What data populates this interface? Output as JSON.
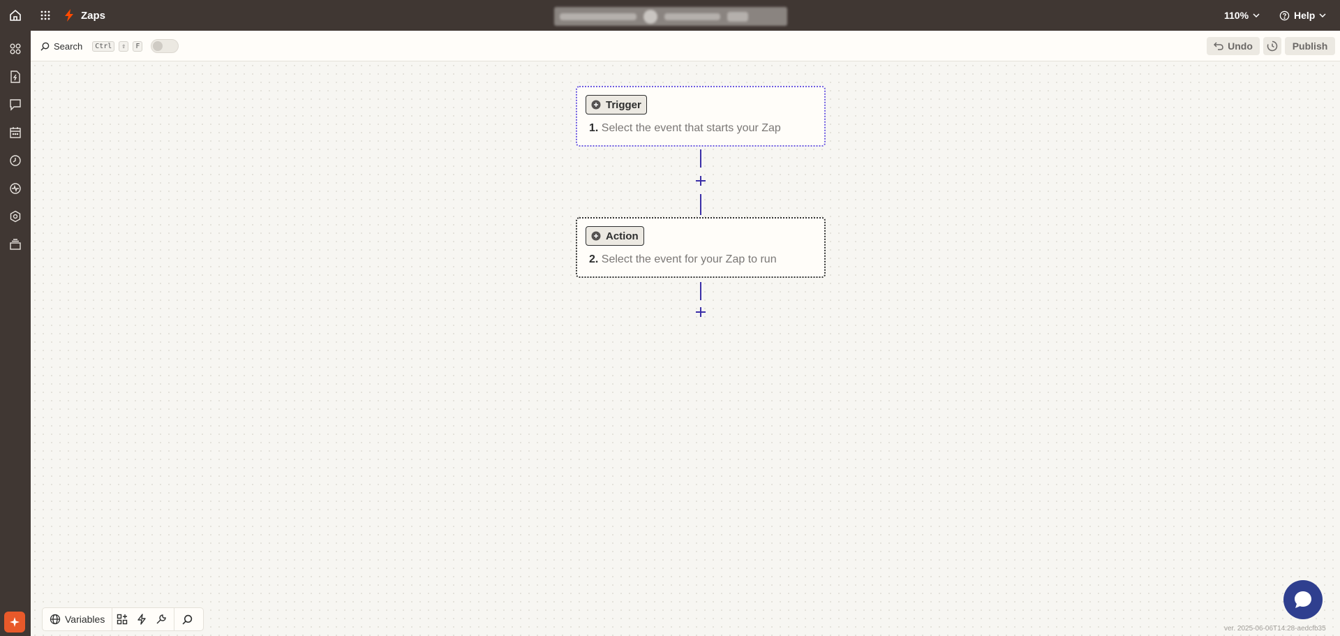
{
  "topbar": {
    "title": "Zaps",
    "zoom": "110%",
    "help": "Help",
    "colors": {
      "bar": "#403733",
      "bolt": "#ff4a00"
    }
  },
  "sidebar": {
    "items": [
      "apps-icon",
      "zap-file-icon",
      "chat-icon",
      "calendar-icon",
      "history-icon",
      "activity-icon",
      "settings-icon",
      "layers-icon"
    ]
  },
  "toolbar": {
    "search_label": "Search",
    "shortcut_keys": [
      "Ctrl",
      "⇧",
      "F"
    ],
    "undo_label": "Undo",
    "publish_label": "Publish"
  },
  "steps": [
    {
      "type_label": "Trigger",
      "number": "1.",
      "description": "Select the event that starts your Zap",
      "accent": "#6c5ae0"
    },
    {
      "type_label": "Action",
      "number": "2.",
      "description": "Select the event for your Zap to run",
      "accent": "#2d2e2e"
    }
  ],
  "bottom_bar": {
    "variables_label": "Variables"
  },
  "version": "ver. 2025-06-06T14:28-aedcfb35"
}
